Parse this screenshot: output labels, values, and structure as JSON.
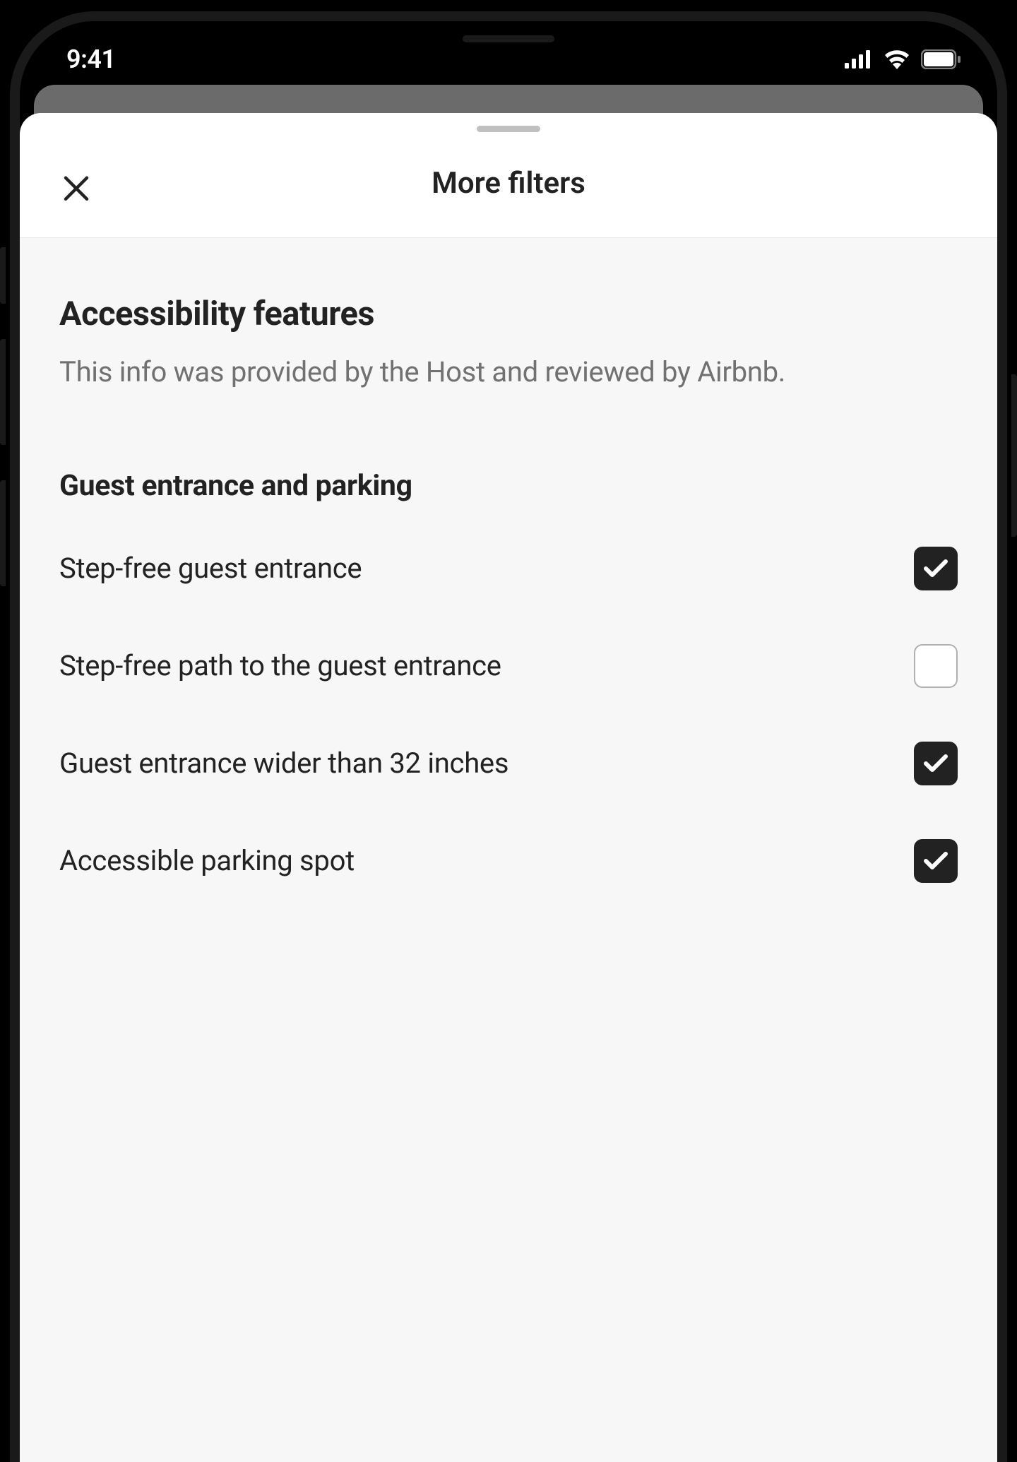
{
  "status_bar": {
    "time": "9:41"
  },
  "sheet": {
    "title": "More filters"
  },
  "section": {
    "title": "Accessibility features",
    "description": "This info was provided by the Host and reviewed by Airbnb."
  },
  "subsection": {
    "title": "Guest entrance and parking",
    "options": [
      {
        "label": "Step-free guest entrance",
        "checked": true
      },
      {
        "label": "Step-free path to the guest entrance",
        "checked": false
      },
      {
        "label": "Guest entrance wider than 32 inches",
        "checked": true
      },
      {
        "label": "Accessible parking spot",
        "checked": true
      }
    ]
  }
}
